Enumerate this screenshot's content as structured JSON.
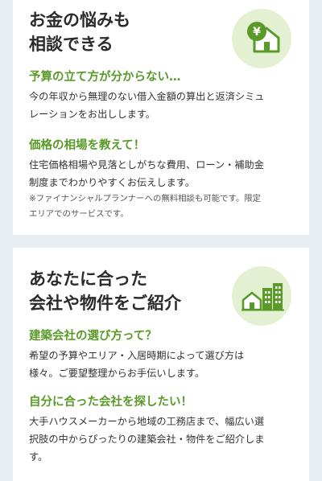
{
  "consultation": {
    "title_line1": "お金の悩みも",
    "title_line2": "相談できる",
    "icon": "yen-house-icon",
    "q1": {
      "heading": "予算の立て方が分からない…",
      "line1": "今の年収から無理のない借入金額の算出と返済シミュ",
      "line2": "レーションをお出しします。"
    },
    "q2": {
      "heading": "価格の相場を教えて！",
      "line1": "住宅価格相場や見落としがちな費用、ローン・補助金",
      "line2": "制度までわかりやすくお伝えします。"
    },
    "note_line1": "※ファイナンシャルプランナーへの無料相談も可能です。限定",
    "note_line2": "エリアでのサービスです。"
  },
  "introduction": {
    "title_line1": "あなたに合った",
    "title_line2": "会社や物件をご紹介",
    "icon": "house-buildings-icon",
    "q1": {
      "heading": "建築会社の選び方って？",
      "line1": "希望の予算やエリア・入居時期によって選び方は",
      "line2": "様々。ご要望整理からお手伝いします。"
    },
    "q2": {
      "heading": "自分に合った会社を探したい！",
      "line1": "大手ハウスメーカーから地域の工務店まで、幅広い選",
      "line2": "択肢の中からぴったりの建築会社・物件をご紹介しま",
      "line3": "す。"
    }
  },
  "colors": {
    "accent_green": "#5a9a29",
    "icon_circle_bg": "#e4f0d2",
    "page_bg": "#e9eef2"
  }
}
